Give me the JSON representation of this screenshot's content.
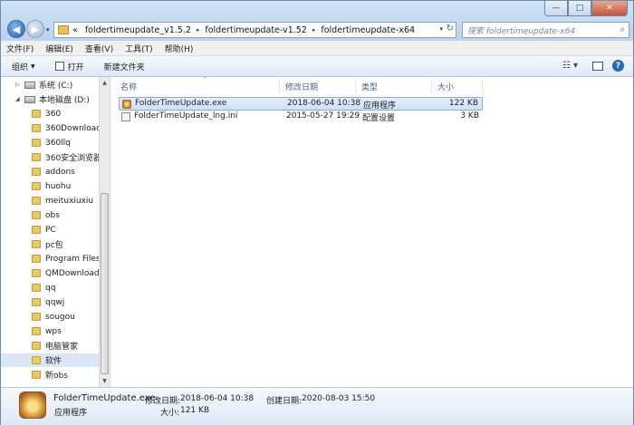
{
  "window": {
    "controls": {
      "minimize": "—",
      "maximize": "□",
      "close": "✕"
    }
  },
  "nav": {
    "back": "◀",
    "forward": "▶",
    "history": "▾"
  },
  "address": {
    "prefix": "«",
    "crumbs": [
      "foldertimeupdate_v1.5.2",
      "foldertimeupdate-v1.52",
      "foldertimeupdate-x64"
    ],
    "sep": "▸",
    "dropdown": "▾",
    "refresh": "↻"
  },
  "search": {
    "placeholder": "搜索 foldertimeupdate-x64",
    "icon": "⌕"
  },
  "menu": [
    "文件(F)",
    "编辑(E)",
    "查看(V)",
    "工具(T)",
    "帮助(H)"
  ],
  "toolbar": {
    "organize": "组织",
    "open": "打开",
    "new_folder": "新建文件夹",
    "views": "☷ ▾",
    "help": "?"
  },
  "sidebar": {
    "items": [
      {
        "label": "系统 (C:)",
        "kind": "drive"
      },
      {
        "label": "本地磁盘 (D:)",
        "kind": "drive"
      },
      {
        "label": "360",
        "kind": "folder"
      },
      {
        "label": "360Downloads",
        "kind": "folder"
      },
      {
        "label": "360llq",
        "kind": "folder"
      },
      {
        "label": "360安全浏览器",
        "kind": "folder"
      },
      {
        "label": "addons",
        "kind": "folder"
      },
      {
        "label": "huohu",
        "kind": "folder"
      },
      {
        "label": "meituxiuxiu",
        "kind": "folder"
      },
      {
        "label": "obs",
        "kind": "folder"
      },
      {
        "label": "PC",
        "kind": "folder"
      },
      {
        "label": "pc包",
        "kind": "folder"
      },
      {
        "label": "Program Files",
        "kind": "folder"
      },
      {
        "label": "QMDownload",
        "kind": "folder"
      },
      {
        "label": "qq",
        "kind": "folder"
      },
      {
        "label": "qqwj",
        "kind": "folder"
      },
      {
        "label": "sougou",
        "kind": "folder"
      },
      {
        "label": "wps",
        "kind": "folder"
      },
      {
        "label": "电脑管家",
        "kind": "folder"
      },
      {
        "label": "软件",
        "kind": "folder",
        "selected": true
      },
      {
        "label": "新obs",
        "kind": "folder"
      }
    ],
    "scroll": {
      "up": "▲",
      "down": "▼"
    }
  },
  "columns": {
    "name": "名称",
    "modified": "修改日期",
    "type": "类型",
    "size": "大小",
    "sort_indicator": "^"
  },
  "files": [
    {
      "name": "FolderTimeUpdate.exe",
      "modified": "2018-06-04 10:38",
      "type": "应用程序",
      "size": "122 KB",
      "icon": "exe-icon",
      "selected": true
    },
    {
      "name": "FolderTimeUpdate_lng.ini",
      "modified": "2015-05-27 19:29",
      "type": "配置设置",
      "size": "3 KB",
      "icon": "ini-icon"
    }
  ],
  "details": {
    "name": "FolderTimeUpdate.exe",
    "type": "应用程序",
    "modified_label": "修改日期:",
    "modified_value": "2018-06-04 10:38",
    "created_label": "创建日期:",
    "created_value": "2020-08-03 15:50",
    "size_label": "大小:",
    "size_value": "121 KB"
  }
}
